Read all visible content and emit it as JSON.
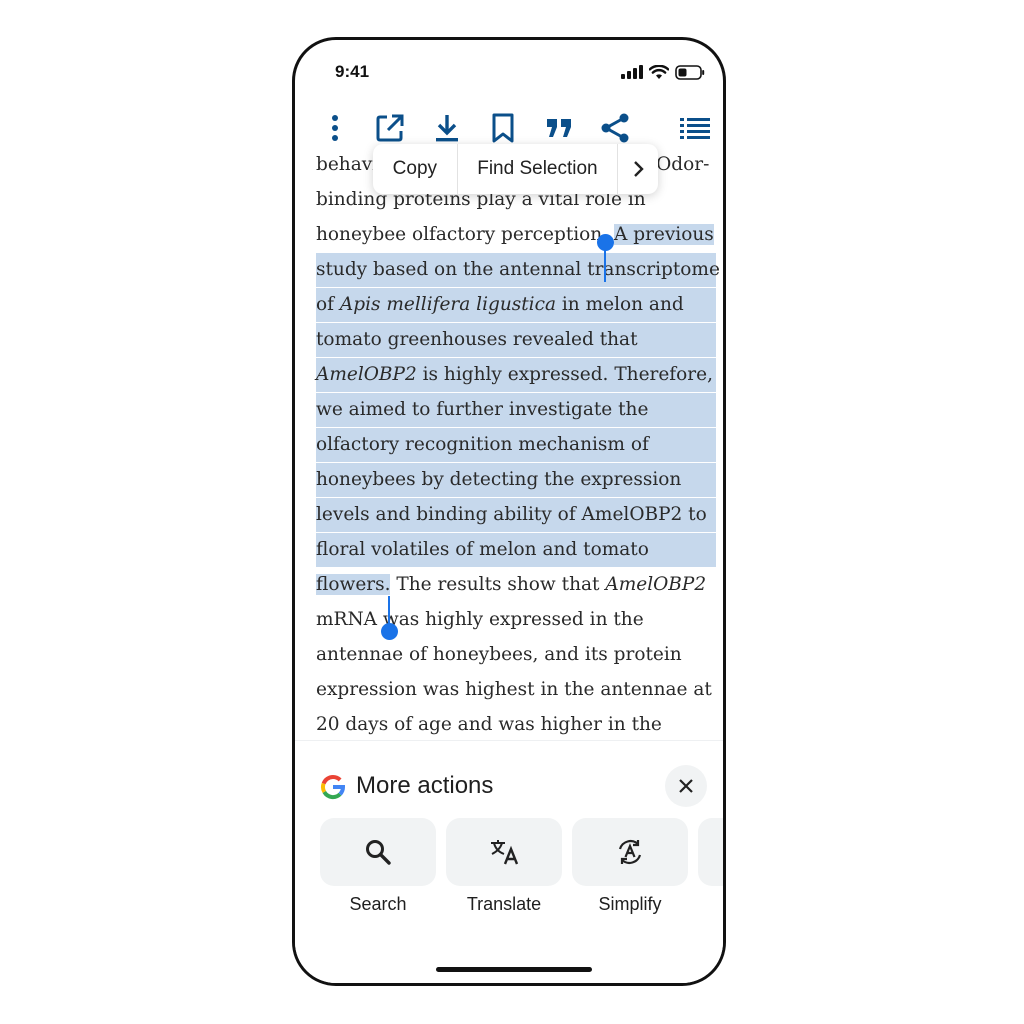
{
  "status_bar": {
    "time": "9:41",
    "icons": [
      "signal-icon",
      "wifi-icon",
      "battery-icon"
    ]
  },
  "toolbar": {
    "icons": [
      "more-vertical-icon",
      "open-external-icon",
      "download-icon",
      "bookmark-icon",
      "cite-icon",
      "share-icon",
      "contents-list-icon"
    ],
    "accent_color": "#0b4f8a"
  },
  "context_menu": {
    "copy_label": "Copy",
    "find_label": "Find Selection",
    "more_label": ">"
  },
  "article": {
    "line_0a": "behavi",
    "line_0b": "Odor-",
    "line_1": "binding proteins play a vital role in",
    "line_2_plain": "honeybee olfactory perception. ",
    "line_2_sel": "A previous",
    "line_3": "study based on the antennal transcriptome",
    "line_4_pre": "of ",
    "line_4_italic": "Apis mellifera ligustica",
    "line_4_post": " in melon and",
    "line_5": "tomato greenhouses revealed that",
    "line_6_italic": "AmelOBP2",
    "line_6_post": " is highly expressed. Therefore,",
    "line_7": "we aimed to further investigate the",
    "line_8": "olfactory recognition mechanism of",
    "line_9": "honeybees by detecting the expression",
    "line_10": "levels and binding ability of AmelOBP2 to",
    "line_11": "floral volatiles of melon and tomato",
    "line_12_sel": "flowers.",
    "line_12_post": " The results show that ",
    "line_12_italic": "AmelOBP2",
    "line_13": "mRNA was highly expressed in the",
    "line_14": "antennae of honeybees, and its protein",
    "line_15": "expression was highest in the antennae at",
    "line_16": "20 days of age and was higher in the",
    "selection_color": "#c6d8ec",
    "handle_color": "#1a73e8"
  },
  "bottom_sheet": {
    "logo": "google-g-icon",
    "title": "More actions",
    "close_icon": "close-icon",
    "actions": [
      {
        "label": "Search",
        "icon": "search-icon"
      },
      {
        "label": "Translate",
        "icon": "translate-icon"
      },
      {
        "label": "Simplify",
        "icon": "simplify-icon"
      }
    ]
  }
}
